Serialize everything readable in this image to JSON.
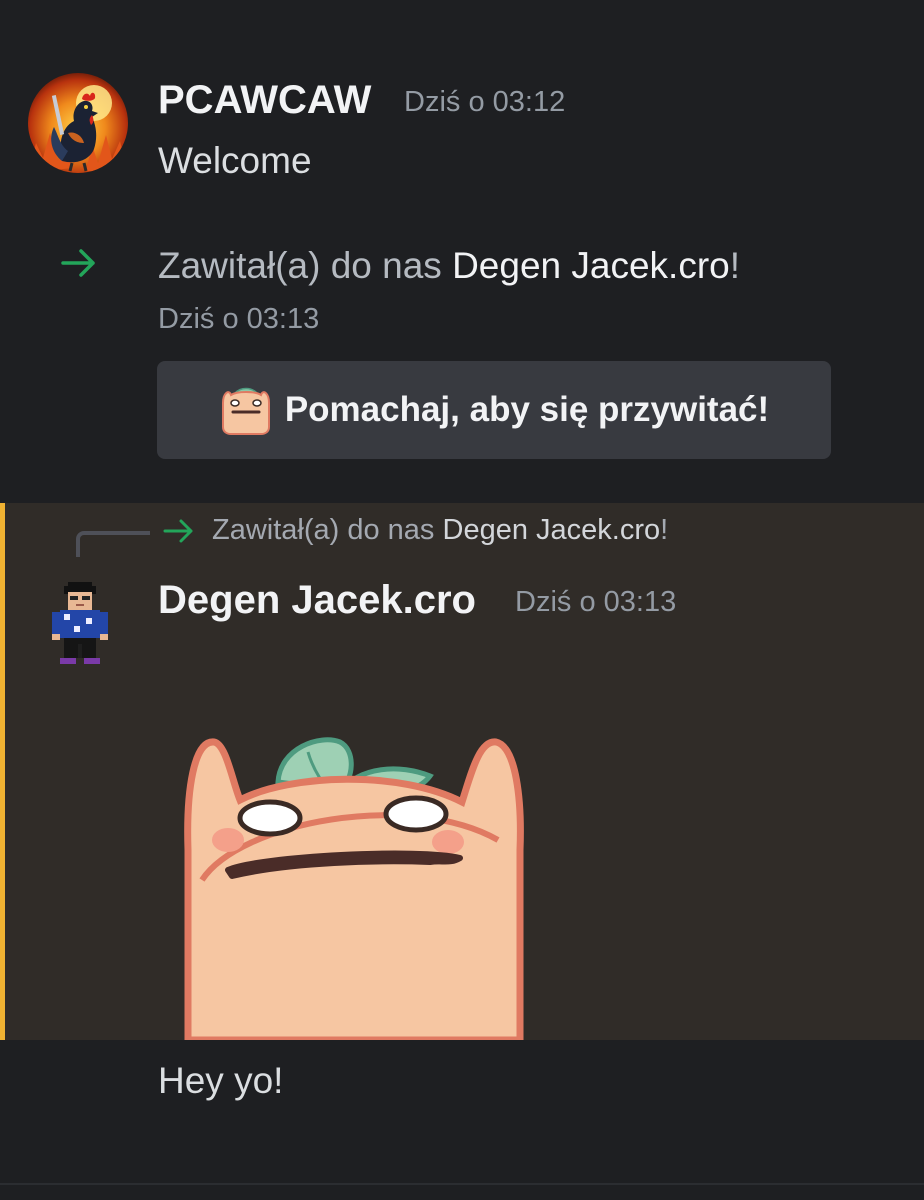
{
  "messages": [
    {
      "author": "PCAWCAW",
      "timestamp": "Dziś o 03:12",
      "content": "Welcome"
    }
  ],
  "join_event": {
    "prefix": "Zawitał(a) do nas ",
    "user": "Degen Jacek.cro",
    "suffix": "!",
    "timestamp": "Dziś o 03:13",
    "wave_button_label": "Pomachaj, aby się przywitać!"
  },
  "reply": {
    "prefix": "Zawitał(a) do nas ",
    "user": "Degen Jacek.cro",
    "suffix": "!"
  },
  "highlighted_message": {
    "author": "Degen Jacek.cro",
    "timestamp": "Dziś o 03:13",
    "sticker": "peach-sticker-icon"
  },
  "followup_message": {
    "content": "Hey yo!"
  },
  "colors": {
    "background": "#1e1f22",
    "highlight_bg": "#302c28",
    "highlight_bar": "#f0b232",
    "join_arrow": "#23a55a",
    "button_bg": "#383a40"
  }
}
